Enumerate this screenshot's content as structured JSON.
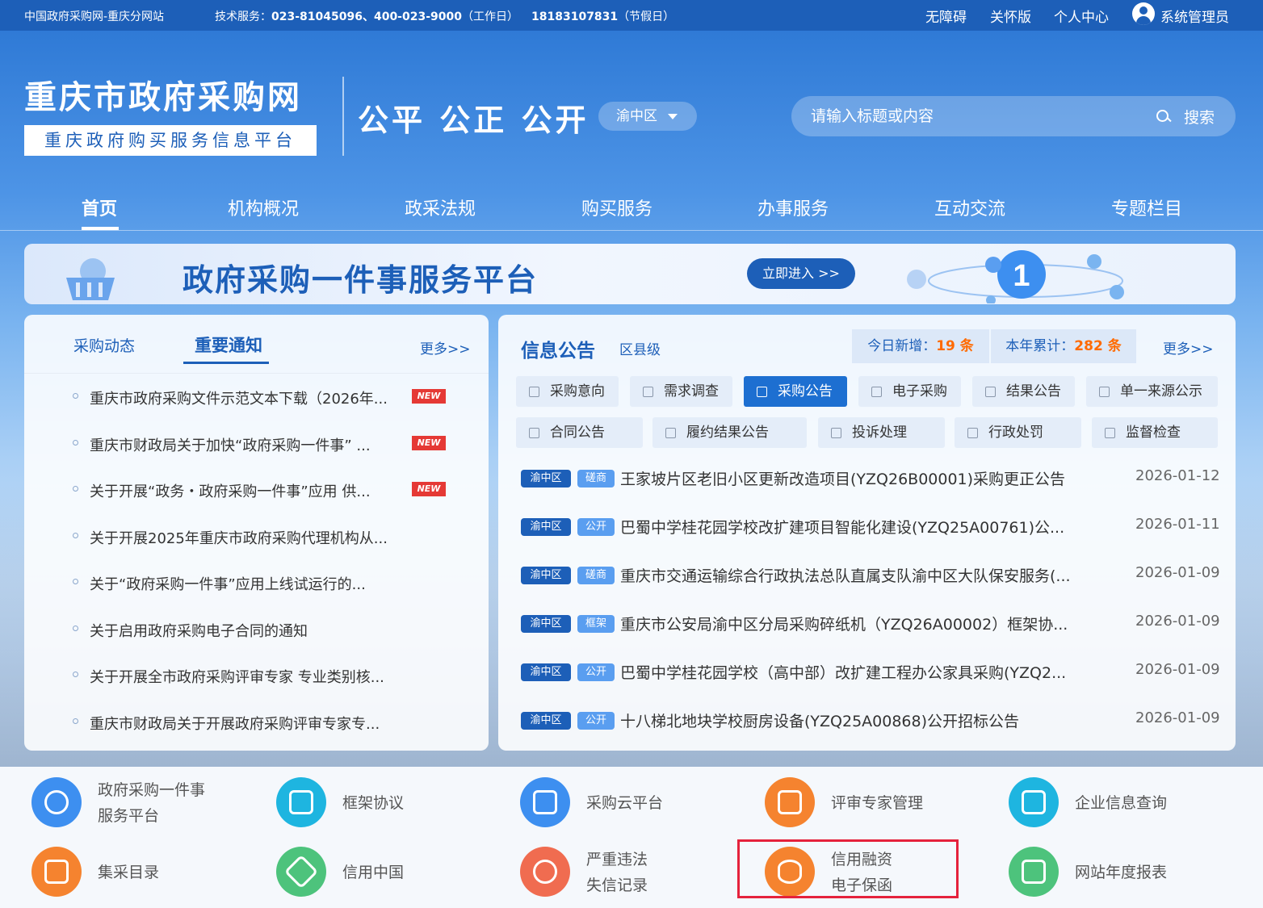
{
  "topbar": {
    "site_name": "中国政府采购网-重庆分网站",
    "service_prefix": "技术服务：",
    "service_phones": "023-81045096、400-023-9000",
    "workday_note": "（工作日）",
    "holiday_phone": "18183107831",
    "holiday_note": "（节假日）",
    "links": [
      "无障碍",
      "关怀版",
      "个人中心"
    ],
    "user": "系统管理员"
  },
  "header": {
    "logo_title": "重庆市政府采购网",
    "logo_subtitle": "重庆政府购买服务信息平台",
    "slogan": "公平 公正 公开",
    "region": "渝中区",
    "search_placeholder": "请输入标题或内容",
    "search_label": "搜索"
  },
  "nav": [
    "首页",
    "机构概况",
    "政采法规",
    "购买服务",
    "办事服务",
    "互动交流",
    "专题栏目"
  ],
  "banner": {
    "title": "政府采购一件事服务平台",
    "button": "立即进入 >>"
  },
  "left_panel": {
    "tabs": [
      "采购动态",
      "重要通知"
    ],
    "more": "更多>>",
    "items": [
      {
        "text": "重庆市政府采购文件示范文本下载（2026年...",
        "badge": "NEW"
      },
      {
        "text": "重庆市财政局关于加快“政府采购一件事” ...",
        "badge": "NEW"
      },
      {
        "text": "关于开展“政务・政府采购一件事”应用 供...",
        "badge": "NEW"
      },
      {
        "text": "关于开展2025年重庆市政府采购代理机构从...",
        "badge": ""
      },
      {
        "text": "关于“政府采购一件事”应用上线试运行的...",
        "badge": ""
      },
      {
        "text": "关于启用政府采购电子合同的通知",
        "badge": ""
      },
      {
        "text": "关于开展全市政府采购评审专家 专业类别核...",
        "badge": ""
      },
      {
        "text": "重庆市财政局关于开展政府采购评审专家专...",
        "badge": ""
      }
    ]
  },
  "right_panel": {
    "title": "信息公告",
    "level": "区县级",
    "today_label": "今日新增：",
    "today_count": "19 条",
    "year_label": "本年累计：",
    "year_count": "282 条",
    "more": "更多>>",
    "categories_row1": [
      "采购意向",
      "需求调查",
      "采购公告",
      "电子采购",
      "结果公告",
      "单一来源公示"
    ],
    "categories_row2": [
      "合同公告",
      "履约结果公告",
      "投诉处理",
      "行政处罚",
      "监督检查"
    ],
    "active_category": "采购公告",
    "announcements": [
      {
        "region": "渝中区",
        "type": "磋商",
        "title": "王家坡片区老旧小区更新改造项目(YZQ26B00001)采购更正公告",
        "date": "2026-01-12"
      },
      {
        "region": "渝中区",
        "type": "公开",
        "title": "巴蜀中学桂花园学校改扩建项目智能化建设(YZQ25A00761)公...",
        "date": "2026-01-11"
      },
      {
        "region": "渝中区",
        "type": "磋商",
        "title": "重庆市交通运输综合行政执法总队直属支队渝中区大队保安服务(...",
        "date": "2026-01-09"
      },
      {
        "region": "渝中区",
        "type": "框架",
        "title": "重庆市公安局渝中区分局采购碎纸机（YZQ26A00002）框架协...",
        "date": "2026-01-09"
      },
      {
        "region": "渝中区",
        "type": "公开",
        "title": "巴蜀中学桂花园学校（高中部）改扩建工程办公家具采购(YZQ2...",
        "date": "2026-01-09"
      },
      {
        "region": "渝中区",
        "type": "公开",
        "title": "十八梯北地块学校厨房设备(YZQ25A00868)公开招标公告",
        "date": "2026-01-09"
      }
    ]
  },
  "quick_links": [
    {
      "line1": "政府采购一件事",
      "line2": "服务平台",
      "icon": "target-icon",
      "color": "#3d8ff0"
    },
    {
      "line1": "框架协议",
      "line2": "",
      "icon": "framework-icon",
      "color": "#1eb5e0"
    },
    {
      "line1": "采购云平台",
      "line2": "",
      "icon": "monitor-icon",
      "color": "#3d8ff0"
    },
    {
      "line1": "评审专家管理",
      "line2": "",
      "icon": "expert-icon",
      "color": "#f5832f"
    },
    {
      "line1": "企业信息查询",
      "line2": "",
      "icon": "truck-icon",
      "color": "#1eb5e0"
    },
    {
      "line1": "集采目录",
      "line2": "",
      "icon": "clipboard-icon",
      "color": "#f5832f"
    },
    {
      "line1": "信用中国",
      "line2": "",
      "icon": "shield-check-icon",
      "color": "#4dc37c"
    },
    {
      "line1": "严重违法",
      "line2": "失信记录",
      "icon": "user-warning-icon",
      "color": "#f06c50"
    },
    {
      "line1": "信用融资",
      "line2": "电子保函",
      "icon": "database-icon",
      "color": "#f5832f"
    },
    {
      "line1": "网站年度报表",
      "line2": "",
      "icon": "report-icon",
      "color": "#4dc37c"
    }
  ]
}
